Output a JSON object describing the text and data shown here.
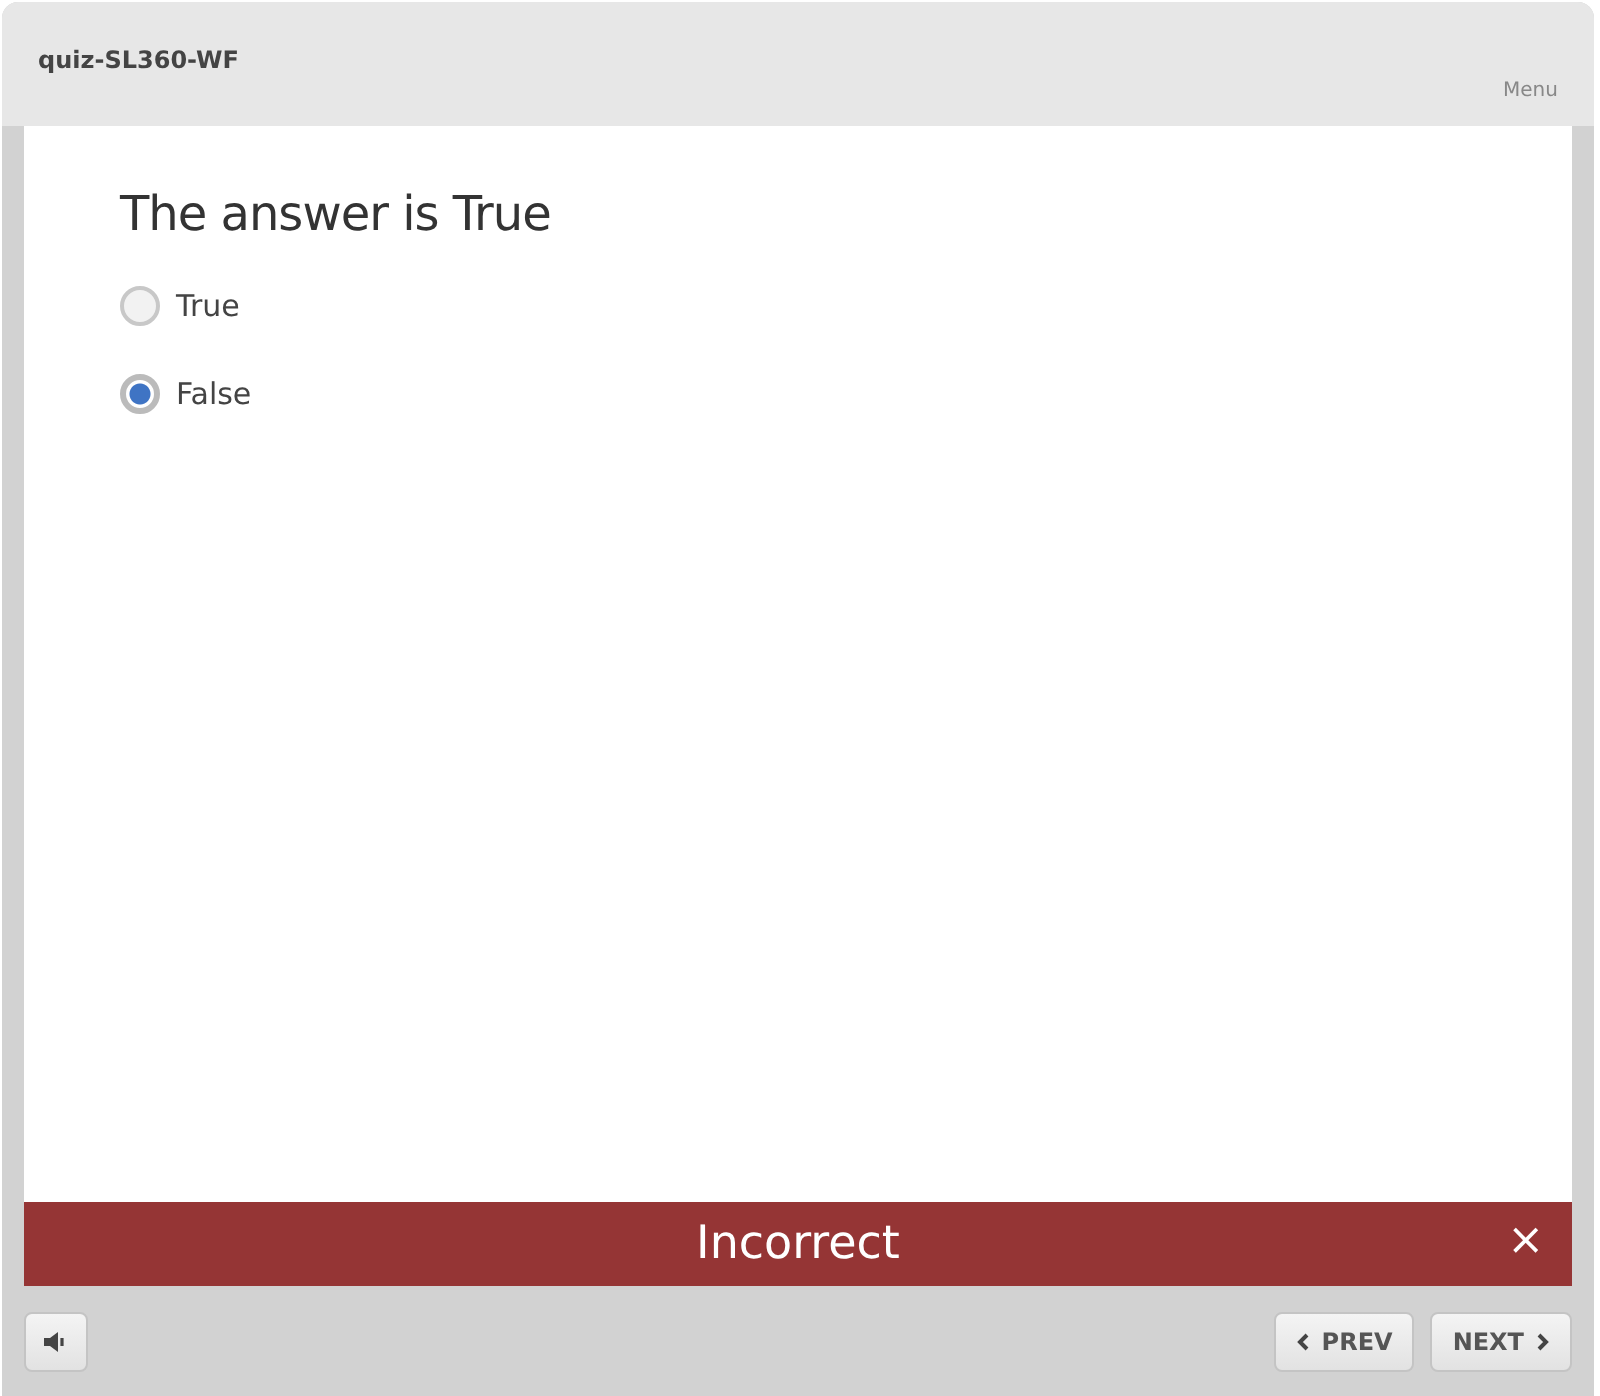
{
  "header": {
    "title": "quiz-SL360-WF",
    "menu": "Menu"
  },
  "question": {
    "prompt": "The answer is True",
    "options": [
      {
        "label": "True",
        "selected": false
      },
      {
        "label": "False",
        "selected": true
      }
    ]
  },
  "feedback": {
    "text": "Incorrect",
    "close": "×"
  },
  "footer": {
    "prev": "PREV",
    "next": "NEXT"
  }
}
